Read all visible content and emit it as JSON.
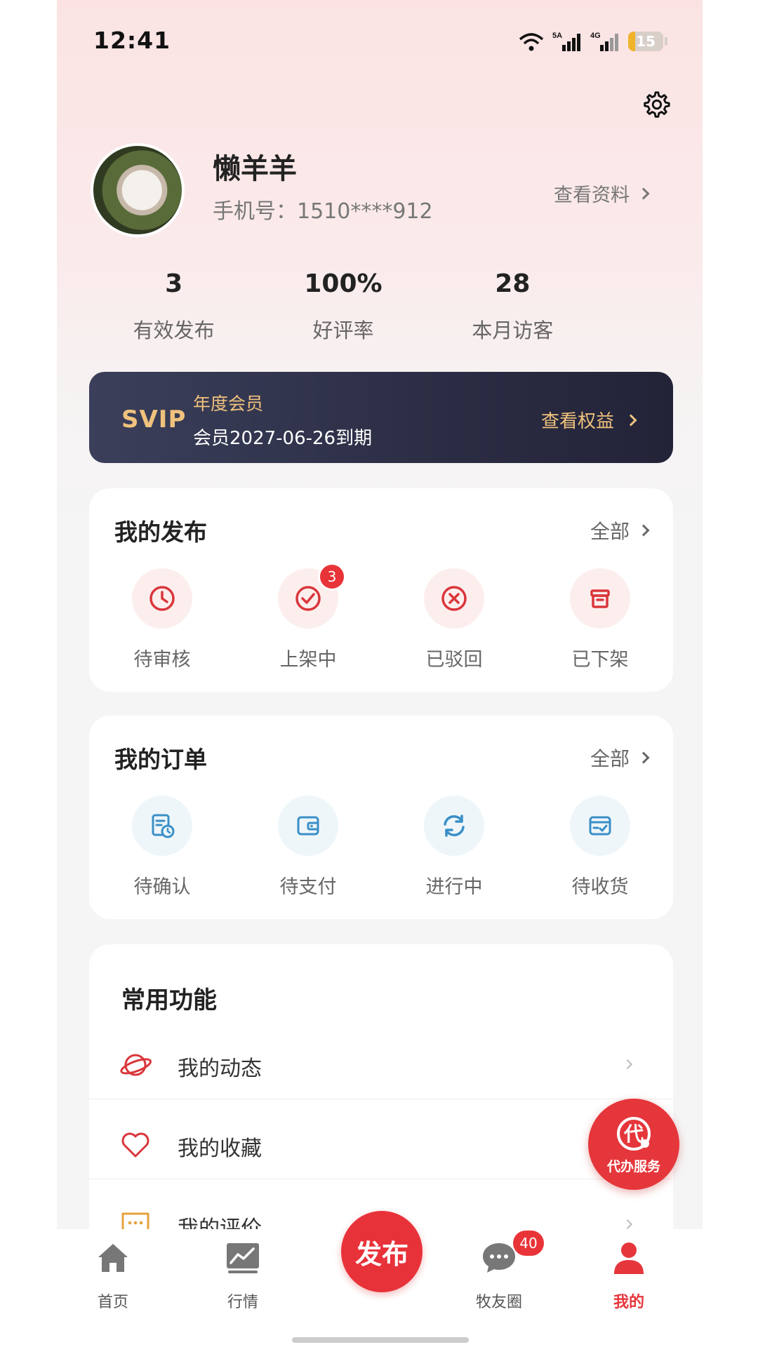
{
  "status_bar": {
    "time": "12:41",
    "signal1": "5A",
    "signal2": "4G",
    "battery": "15"
  },
  "profile": {
    "name": "懒羊羊",
    "phone": "手机号：1510****912",
    "view_profile": "查看资料"
  },
  "stats": [
    {
      "value": "3",
      "label": "有效发布"
    },
    {
      "value": "100%",
      "label": "好评率"
    },
    {
      "value": "28",
      "label": "本月访客"
    }
  ],
  "svip": {
    "tag": "SVIP",
    "title": "年度会员",
    "expiry": "会员2027-06-26到期",
    "link": "查看权益"
  },
  "my_publish": {
    "title": "我的发布",
    "all": "全部",
    "items": [
      {
        "label": "待审核",
        "icon": "clock-icon"
      },
      {
        "label": "上架中",
        "icon": "check-circle-icon",
        "badge": "3"
      },
      {
        "label": "已驳回",
        "icon": "x-circle-icon"
      },
      {
        "label": "已下架",
        "icon": "archive-box-icon"
      }
    ]
  },
  "my_orders": {
    "title": "我的订单",
    "all": "全部",
    "items": [
      {
        "label": "待确认",
        "icon": "document-clock-icon"
      },
      {
        "label": "待支付",
        "icon": "wallet-icon"
      },
      {
        "label": "进行中",
        "icon": "refresh-icon"
      },
      {
        "label": "待收货",
        "icon": "box-check-icon"
      }
    ]
  },
  "common_functions": {
    "title": "常用功能",
    "items": [
      {
        "label": "我的动态",
        "icon": "planet-icon"
      },
      {
        "label": "我的收藏",
        "icon": "heart-icon"
      },
      {
        "label": "我的评价",
        "icon": "comment-icon"
      }
    ]
  },
  "float_service": {
    "label": "代办服务",
    "glyph": "代"
  },
  "tabbar": {
    "home": "首页",
    "market": "行情",
    "publish": "发布",
    "circle": "牧友圈",
    "mine": "我的",
    "circle_badge": "40"
  },
  "colors": {
    "accent": "#e5363b",
    "gold": "#f0c27d",
    "svip_bg": "#2b2d44",
    "icon_blue": "#3a8fc7"
  }
}
